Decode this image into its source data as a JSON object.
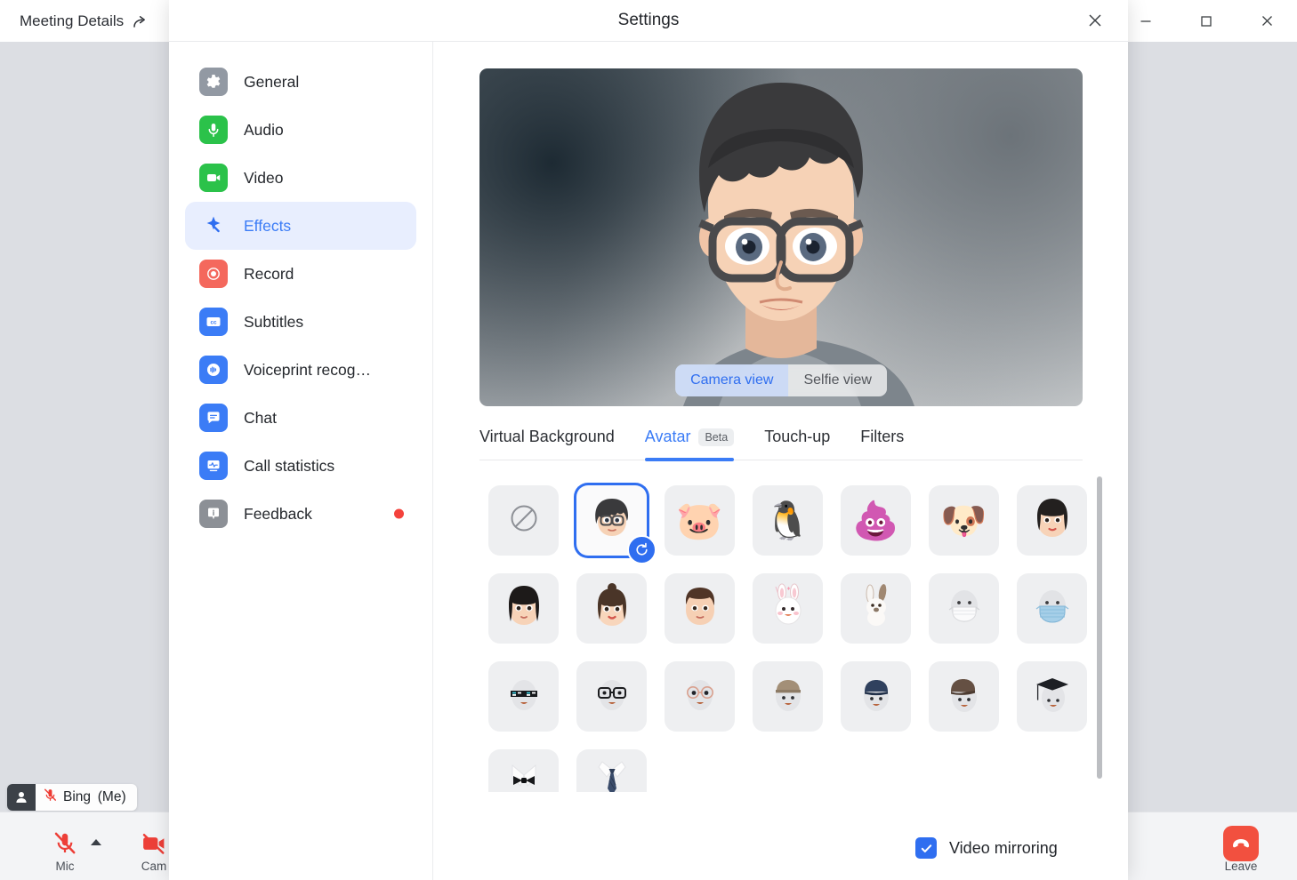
{
  "app": {
    "meeting_details_label": "Meeting Details",
    "share_icon": "share-arrow-icon",
    "window_controls": {
      "minimize": "minimize-icon",
      "maximize": "maximize-icon",
      "close": "close-icon"
    },
    "self_tile": {
      "name": "Bing (Me)",
      "person_icon": "person-icon",
      "mic_muted_icon": "mic-muted-icon"
    },
    "toolbar": [
      {
        "id": "mic",
        "label": "Mic",
        "icon": "mic-muted-icon",
        "has_caret": true
      },
      {
        "id": "camera",
        "label": "Cam",
        "icon": "camera-off-icon",
        "has_caret": false
      },
      {
        "id": "leave",
        "label": "Leave",
        "icon": "phone-hangup-icon",
        "has_caret": false
      }
    ]
  },
  "settings": {
    "title": "Settings",
    "close_icon": "close-icon",
    "sidebar": [
      {
        "label": "General",
        "icon": "gear-icon",
        "color": "#9299a3",
        "active": false,
        "badge": false
      },
      {
        "label": "Audio",
        "icon": "microphone-icon",
        "color": "#2bc24a",
        "active": false,
        "badge": false
      },
      {
        "label": "Video",
        "icon": "camera-icon",
        "color": "#2bc24a",
        "active": false,
        "badge": false
      },
      {
        "label": "Effects",
        "icon": "magic-wand-icon",
        "color": "#2f6ef0",
        "active": true,
        "badge": false
      },
      {
        "label": "Record",
        "icon": "record-icon",
        "color": "#f4685d",
        "active": false,
        "badge": false
      },
      {
        "label": "Subtitles",
        "icon": "closed-caption-icon",
        "color": "#3b7cf6",
        "active": false,
        "badge": false
      },
      {
        "label": "Voiceprint recog…",
        "icon": "voiceprint-icon",
        "color": "#3b7cf6",
        "active": false,
        "badge": false
      },
      {
        "label": "Chat",
        "icon": "chat-bubble-icon",
        "color": "#3b7cf6",
        "active": false,
        "badge": false
      },
      {
        "label": "Call statistics",
        "icon": "statistics-icon",
        "color": "#3b7cf6",
        "active": false,
        "badge": false
      },
      {
        "label": "Feedback",
        "icon": "info-icon",
        "color": "#8c9096",
        "active": false,
        "badge": true
      }
    ],
    "preview": {
      "view_options": [
        {
          "label": "Camera view",
          "selected": true
        },
        {
          "label": "Selfie view",
          "selected": false
        }
      ]
    },
    "tabs": [
      {
        "label": "Virtual Background",
        "active": false,
        "chip": null
      },
      {
        "label": "Avatar",
        "active": true,
        "chip": "Beta"
      },
      {
        "label": "Touch-up",
        "active": false,
        "chip": null
      },
      {
        "label": "Filters",
        "active": false,
        "chip": null
      }
    ],
    "avatar_grid": [
      {
        "name": "none",
        "kind": "none",
        "selected": false
      },
      {
        "name": "boy-glasses",
        "kind": "person",
        "selected": true
      },
      {
        "name": "pig",
        "kind": "emoji",
        "glyph": "🐷",
        "selected": false
      },
      {
        "name": "bird",
        "kind": "emoji",
        "glyph": "🐧",
        "selected": false
      },
      {
        "name": "pink-poop",
        "kind": "emoji",
        "glyph": "💩",
        "selected": false
      },
      {
        "name": "pug-dog",
        "kind": "emoji",
        "glyph": "🐶",
        "selected": false
      },
      {
        "name": "woman-bob-hair",
        "kind": "person",
        "selected": false
      },
      {
        "name": "woman-long-black-hair",
        "kind": "person",
        "selected": false
      },
      {
        "name": "girl-bun-hair",
        "kind": "person",
        "selected": false
      },
      {
        "name": "man-short-hair",
        "kind": "person",
        "selected": false
      },
      {
        "name": "bunny-hood",
        "kind": "emoji",
        "glyph": "🐰",
        "selected": false
      },
      {
        "name": "rabbit",
        "kind": "emoji",
        "glyph": "🐇",
        "selected": false
      },
      {
        "name": "white-face-mask",
        "kind": "mask",
        "variant": "white",
        "selected": false
      },
      {
        "name": "blue-face-mask",
        "kind": "mask",
        "variant": "blue",
        "selected": false
      },
      {
        "name": "pixel-sunglasses",
        "kind": "accessory",
        "variant": "pixel-shades",
        "selected": false
      },
      {
        "name": "black-glasses",
        "kind": "accessory",
        "variant": "glasses",
        "selected": false
      },
      {
        "name": "round-glasses",
        "kind": "accessory",
        "variant": "round-glasses",
        "selected": false
      },
      {
        "name": "tan-bucket-hat",
        "kind": "accessory",
        "variant": "tan-hat",
        "selected": false
      },
      {
        "name": "navy-cap",
        "kind": "accessory",
        "variant": "navy-cap",
        "selected": false
      },
      {
        "name": "brown-newsboy-cap",
        "kind": "accessory",
        "variant": "brown-cap",
        "selected": false
      },
      {
        "name": "graduation-cap",
        "kind": "accessory",
        "variant": "grad-cap",
        "selected": false
      },
      {
        "name": "bow-tie",
        "kind": "accessory",
        "variant": "bow-tie",
        "selected": false
      },
      {
        "name": "neck-tie",
        "kind": "accessory",
        "variant": "neck-tie",
        "selected": false
      }
    ],
    "refresh_badge_icon": "refresh-icon",
    "video_mirroring": {
      "label": "Video mirroring",
      "checked": true
    }
  },
  "colors": {
    "accent": "#2f6ef0",
    "accent_light": "#3b7cf6",
    "active_nav_bg": "#e8eefe",
    "danger": "#f2503f",
    "badge_red": "#f4423c",
    "window_bg": "#dcdee3",
    "toolbar_bg": "#f3f4f6",
    "tile_bg": "#eeeff1"
  }
}
